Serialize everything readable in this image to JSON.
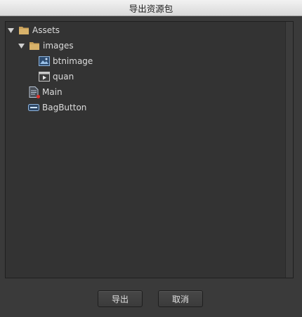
{
  "window": {
    "title": "导出资源包"
  },
  "tree": {
    "items": [
      {
        "label": "Assets",
        "icon": "folder-icon"
      },
      {
        "label": "images",
        "icon": "folder-icon"
      },
      {
        "label": "btnimage",
        "icon": "image-icon"
      },
      {
        "label": "quan",
        "icon": "movieclip-icon"
      },
      {
        "label": "Main",
        "icon": "component-document-icon"
      },
      {
        "label": "BagButton",
        "icon": "button-component-icon"
      }
    ]
  },
  "buttons": {
    "export_label": "导出",
    "cancel_label": "取消"
  },
  "colors": {
    "folder": "#c9a15a",
    "accent_blue": "#6d9cd3",
    "marker_red": "#e0302a"
  }
}
